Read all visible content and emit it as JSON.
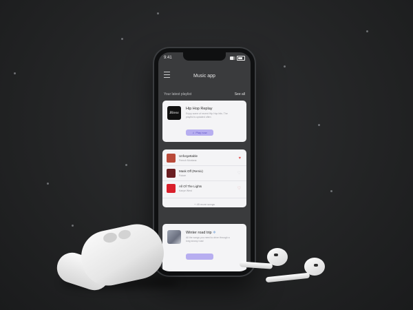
{
  "status": {
    "time": "9:41"
  },
  "appbar": {
    "title": "Music app",
    "menu_icon": "hamburger-icon"
  },
  "section": {
    "label": "Your latest playlist",
    "see_all": "See all"
  },
  "playlist": {
    "cover_text": "Bless",
    "title": "Hip Hop Replay",
    "description": "Enjoy some of recent Hip Hop hits. The playlist is updated often",
    "play_label": "Play now"
  },
  "songs": [
    {
      "name": "Unforgettable",
      "artist": "French Montana",
      "heart_color": "#e25c5c",
      "art_color": "#b94a3a"
    },
    {
      "name": "Mask Off (Remix)",
      "artist": "Future",
      "heart_color": "#cfcfd4",
      "art_color": "#6a1e22"
    },
    {
      "name": "All Of The Lights",
      "artist": "Kanye West",
      "heart_color": "#e9a0a0",
      "art_color": "#d91f2b"
    }
  ],
  "more_songs": "+ 45 more songs",
  "playlist2": {
    "title": "Winter road trip",
    "emoji": "❄",
    "description": "All the songs you need to drive through a long snowy road"
  },
  "colors": {
    "accent": "#b7aef0",
    "accent_text": "#5b50c6",
    "background": "#232425"
  }
}
